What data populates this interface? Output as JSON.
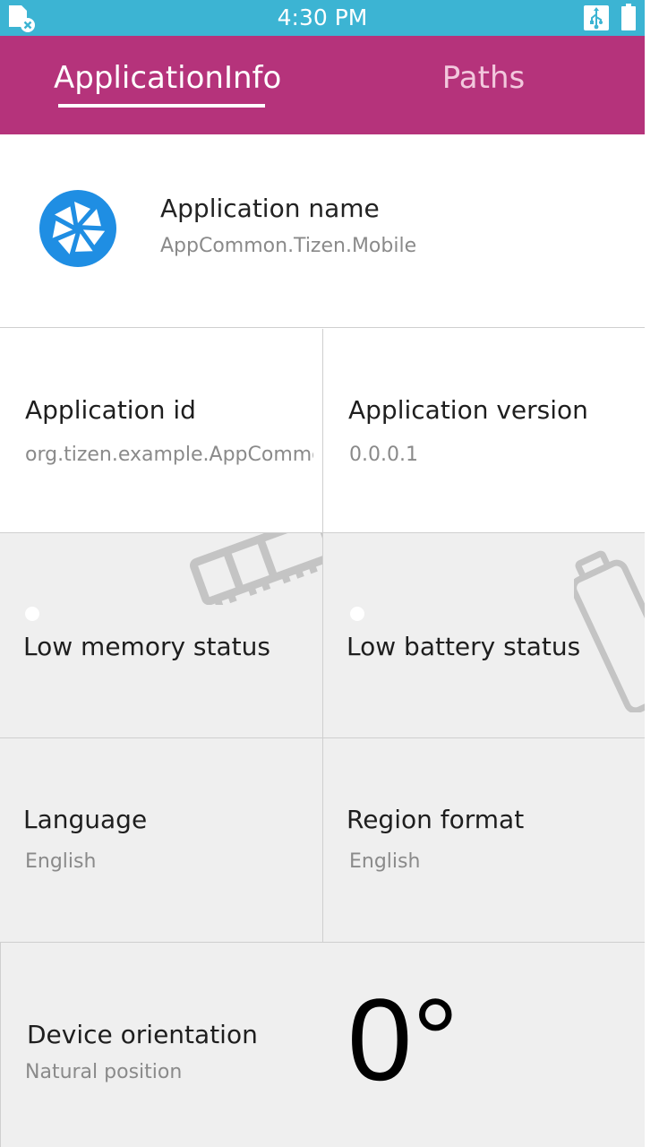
{
  "status_bar": {
    "time": "4:30 PM",
    "icons": [
      "sd-card-error-icon",
      "usb-icon",
      "battery-icon"
    ],
    "color": "#3cb4d3"
  },
  "tabs": [
    {
      "label": "ApplicationInfo",
      "selected": true
    },
    {
      "label": "Paths",
      "selected": false
    }
  ],
  "tab_bar_color": "#b5337b",
  "app": {
    "title": "Application name",
    "name": "AppCommon.Tizen.Mobile",
    "logo_icon": "tizen-pinwheel-icon",
    "logo_color": "#1f8ee3"
  },
  "cells": {
    "app_id": {
      "title": "Application id",
      "value": "org.tizen.example.AppCommon"
    },
    "app_version": {
      "title": "Application version",
      "value": "0.0.0.1"
    },
    "low_memory": {
      "title": "Low memory status",
      "icon": "memory-chip-icon",
      "status": "off"
    },
    "low_battery": {
      "title": "Low battery status",
      "icon": "battery-outline-icon",
      "status": "off"
    },
    "language": {
      "title": "Language",
      "value": "English"
    },
    "region": {
      "title": "Region format",
      "value": "English"
    },
    "orientation": {
      "title": "Device orientation",
      "value": "Natural position",
      "degrees": "0°"
    }
  }
}
